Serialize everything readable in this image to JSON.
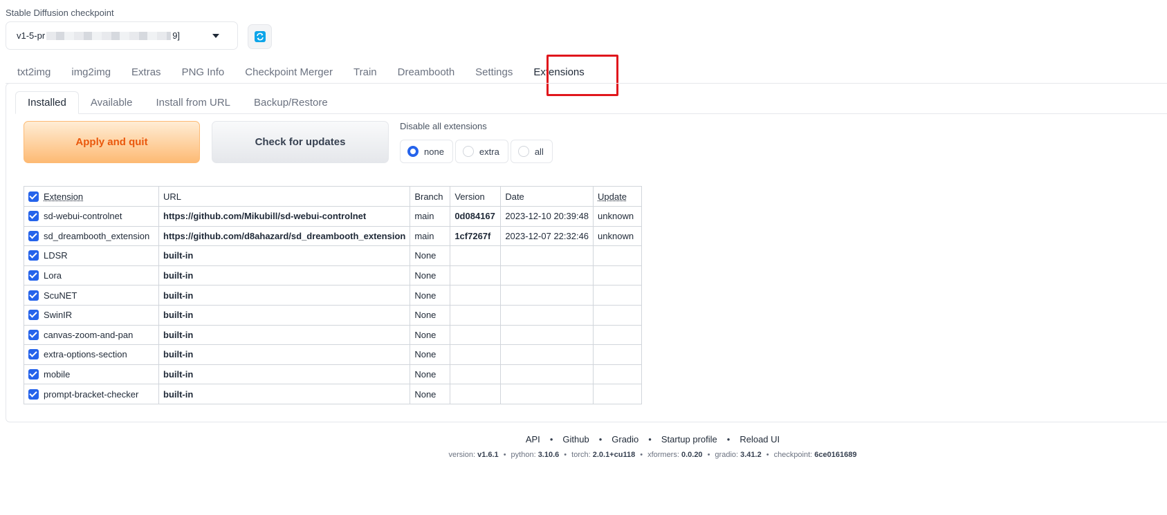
{
  "checkpoint": {
    "label": "Stable Diffusion checkpoint",
    "value_prefix": "v1-5-pr",
    "value_suffix": "9]",
    "refresh_icon": "refresh-icon"
  },
  "main_tabs": [
    "txt2img",
    "img2img",
    "Extras",
    "PNG Info",
    "Checkpoint Merger",
    "Train",
    "Dreambooth",
    "Settings",
    "Extensions"
  ],
  "selected_main_tab": "Extensions",
  "sub_tabs": [
    "Installed",
    "Available",
    "Install from URL",
    "Backup/Restore"
  ],
  "selected_sub_tab": "Installed",
  "buttons": {
    "apply": "Apply and quit",
    "check": "Check for updates"
  },
  "disable": {
    "label": "Disable all extensions",
    "options": [
      "none",
      "extra",
      "all"
    ],
    "selected": "none"
  },
  "table": {
    "headers": [
      "Extension",
      "URL",
      "Branch",
      "Version",
      "Date",
      "Update"
    ],
    "rows": [
      [
        "sd-webui-controlnet",
        "https://github.com/Mikubill/sd-webui-controlnet",
        "main",
        "0d084167",
        "2023-12-10 20:39:48",
        "unknown"
      ],
      [
        "sd_dreambooth_extension",
        "https://github.com/d8ahazard/sd_dreambooth_extension",
        "main",
        "1cf7267f",
        "2023-12-07 22:32:46",
        "unknown"
      ],
      [
        "LDSR",
        "built-in",
        "None",
        "",
        "",
        ""
      ],
      [
        "Lora",
        "built-in",
        "None",
        "",
        "",
        ""
      ],
      [
        "ScuNET",
        "built-in",
        "None",
        "",
        "",
        ""
      ],
      [
        "SwinIR",
        "built-in",
        "None",
        "",
        "",
        ""
      ],
      [
        "canvas-zoom-and-pan",
        "built-in",
        "None",
        "",
        "",
        ""
      ],
      [
        "extra-options-section",
        "built-in",
        "None",
        "",
        "",
        ""
      ],
      [
        "mobile",
        "built-in",
        "None",
        "",
        "",
        ""
      ],
      [
        "prompt-bracket-checker",
        "built-in",
        "None",
        "",
        "",
        ""
      ]
    ]
  },
  "footer": {
    "links": [
      "API",
      "Github",
      "Gradio",
      "Startup profile",
      "Reload UI"
    ],
    "versions": [
      {
        "label": "version: ",
        "value": "v1.6.1"
      },
      {
        "label": "python: ",
        "value": "3.10.6"
      },
      {
        "label": "torch: ",
        "value": "2.0.1+cu118"
      },
      {
        "label": "xformers: ",
        "value": "0.0.20"
      },
      {
        "label": "gradio: ",
        "value": "3.41.2"
      },
      {
        "label": "checkpoint: ",
        "value": "6ce0161689"
      }
    ]
  },
  "colors": {
    "accent": "#2563eb",
    "primary_button_text": "#ea580c",
    "highlight_box": "#e0161c"
  }
}
